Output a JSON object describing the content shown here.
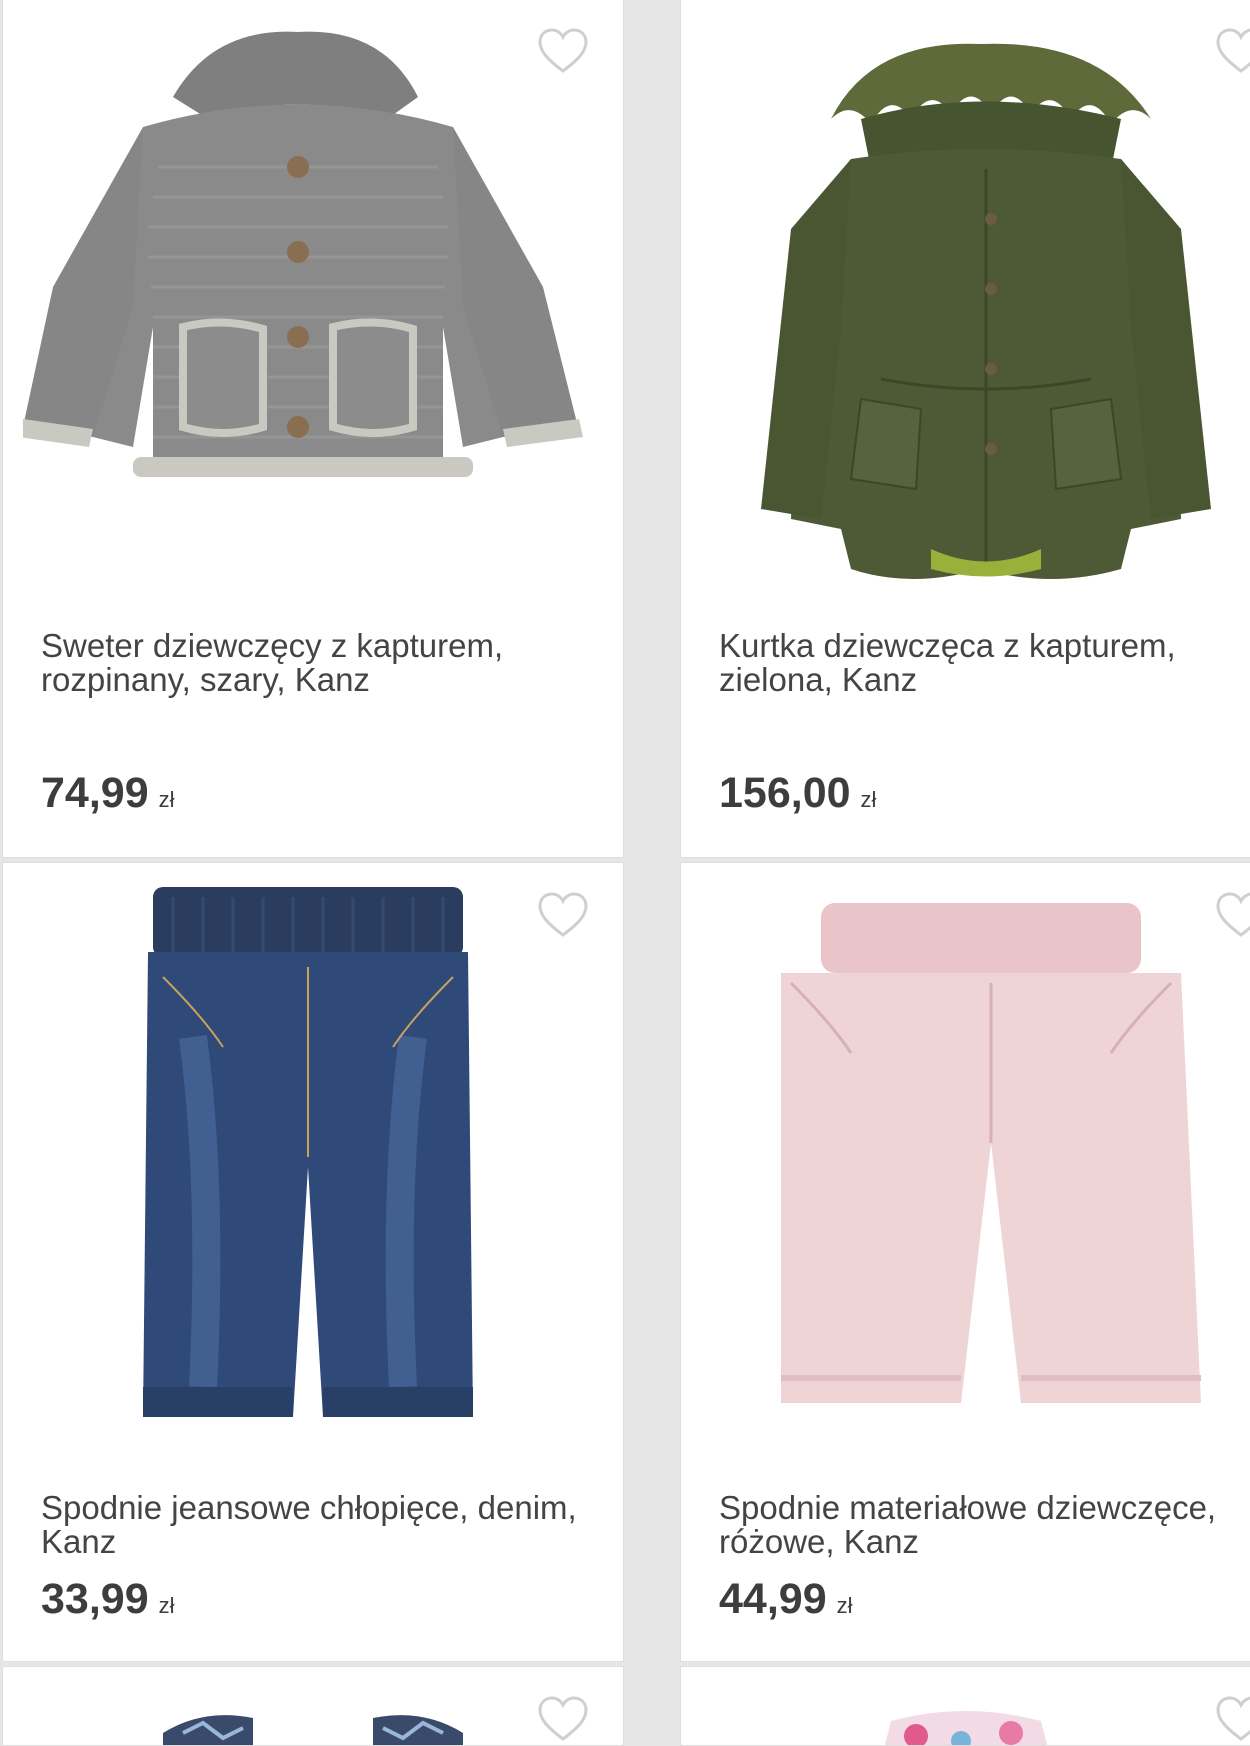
{
  "products": [
    {
      "title": "Sweter dziewczęcy z kapturem, rozpinany, szary, Kanz",
      "price": "74,99",
      "currency": "zł",
      "image": "grey-knit-hooded-cardigan"
    },
    {
      "title": "Kurtka dziewczęca z kapturem, zielona, Kanz",
      "price": "156,00",
      "currency": "zł",
      "image": "green-parka-fur-hood"
    },
    {
      "title": "Spodnie jeansowe chłopięce, denim, Kanz",
      "price": "33,99",
      "currency": "zł",
      "image": "blue-denim-baby-pants"
    },
    {
      "title": "Spodnie materiałowe dziewczęce, różowe, Kanz",
      "price": "44,99",
      "currency": "zł",
      "image": "pink-baby-pants"
    },
    {
      "image": "patterned-top-partial"
    },
    {
      "image": "floral-top-partial"
    }
  ],
  "icons": {
    "favorite": "heart-outline-icon"
  },
  "colors": {
    "card_bg": "#ffffff",
    "gutter": "#e6e6e6",
    "heart": "#cfcfcf",
    "text": "#3d3d3d"
  }
}
